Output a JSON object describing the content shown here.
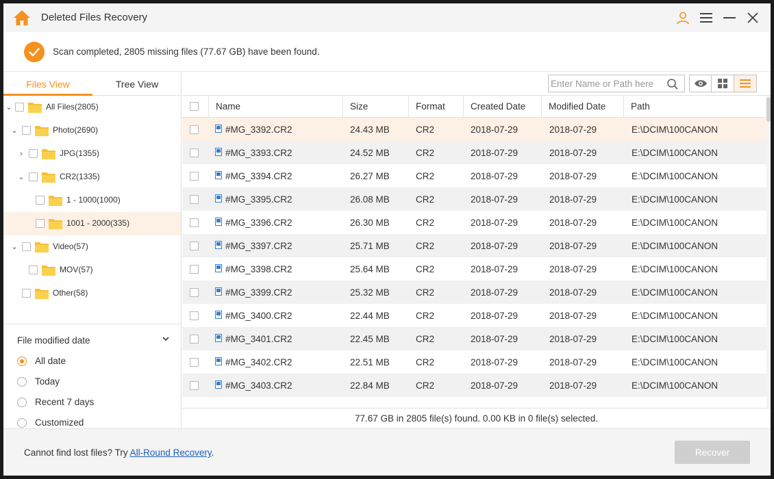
{
  "app": {
    "title": "Deleted Files Recovery"
  },
  "status": {
    "message": "Scan completed, 2805 missing files (77.67 GB) have been found."
  },
  "tabs": [
    {
      "label": "Files View"
    },
    {
      "label": "Tree View"
    }
  ],
  "tree": [
    {
      "label": "All Files(2805)",
      "expanded": true
    },
    {
      "label": "Photo(2690)",
      "expanded": true
    },
    {
      "label": "JPG(1355)",
      "expanded": false
    },
    {
      "label": "CR2(1335)",
      "expanded": true
    },
    {
      "label": "1 - 1000(1000)"
    },
    {
      "label": "1001 - 2000(335)",
      "selected": true
    },
    {
      "label": "Video(57)",
      "expanded": true
    },
    {
      "label": "MOV(57)"
    },
    {
      "label": "Other(58)"
    }
  ],
  "filter": {
    "title": "File modified date",
    "options": [
      {
        "label": "All date",
        "selected": true
      },
      {
        "label": "Today"
      },
      {
        "label": "Recent 7 days"
      },
      {
        "label": "Customized"
      }
    ]
  },
  "search": {
    "placeholder": "Enter Name or Path here"
  },
  "table": {
    "columns": [
      "Name",
      "Size",
      "Format",
      "Created Date",
      "Modified Date",
      "Path"
    ],
    "rows": [
      {
        "name": "#MG_3392.CR2",
        "size": "24.43 MB",
        "format": "CR2",
        "created": "2018-07-29",
        "modified": "2018-07-29",
        "path": "E:\\DCIM\\100CANON"
      },
      {
        "name": "#MG_3393.CR2",
        "size": "24.52 MB",
        "format": "CR2",
        "created": "2018-07-29",
        "modified": "2018-07-29",
        "path": "E:\\DCIM\\100CANON"
      },
      {
        "name": "#MG_3394.CR2",
        "size": "26.27 MB",
        "format": "CR2",
        "created": "2018-07-29",
        "modified": "2018-07-29",
        "path": "E:\\DCIM\\100CANON"
      },
      {
        "name": "#MG_3395.CR2",
        "size": "26.08 MB",
        "format": "CR2",
        "created": "2018-07-29",
        "modified": "2018-07-29",
        "path": "E:\\DCIM\\100CANON"
      },
      {
        "name": "#MG_3396.CR2",
        "size": "26.30 MB",
        "format": "CR2",
        "created": "2018-07-29",
        "modified": "2018-07-29",
        "path": "E:\\DCIM\\100CANON"
      },
      {
        "name": "#MG_3397.CR2",
        "size": "25.71 MB",
        "format": "CR2",
        "created": "2018-07-29",
        "modified": "2018-07-29",
        "path": "E:\\DCIM\\100CANON"
      },
      {
        "name": "#MG_3398.CR2",
        "size": "25.64 MB",
        "format": "CR2",
        "created": "2018-07-29",
        "modified": "2018-07-29",
        "path": "E:\\DCIM\\100CANON"
      },
      {
        "name": "#MG_3399.CR2",
        "size": "25.32 MB",
        "format": "CR2",
        "created": "2018-07-29",
        "modified": "2018-07-29",
        "path": "E:\\DCIM\\100CANON"
      },
      {
        "name": "#MG_3400.CR2",
        "size": "22.44 MB",
        "format": "CR2",
        "created": "2018-07-29",
        "modified": "2018-07-29",
        "path": "E:\\DCIM\\100CANON"
      },
      {
        "name": "#MG_3401.CR2",
        "size": "22.45 MB",
        "format": "CR2",
        "created": "2018-07-29",
        "modified": "2018-07-29",
        "path": "E:\\DCIM\\100CANON"
      },
      {
        "name": "#MG_3402.CR2",
        "size": "22.51 MB",
        "format": "CR2",
        "created": "2018-07-29",
        "modified": "2018-07-29",
        "path": "E:\\DCIM\\100CANON"
      },
      {
        "name": "#MG_3403.CR2",
        "size": "22.84 MB",
        "format": "CR2",
        "created": "2018-07-29",
        "modified": "2018-07-29",
        "path": "E:\\DCIM\\100CANON"
      }
    ]
  },
  "summary": "77.67 GB in 2805 file(s) found. 0.00 KB in 0 file(s) selected.",
  "footer": {
    "prefix": "Cannot find lost files? Try ",
    "link": "All-Round Recovery",
    "suffix": "."
  },
  "recover_button": "Recover",
  "colors": {
    "accent": "#f5911e",
    "selected_row": "#fdf0e5",
    "alt_row": "#f1f1f1",
    "link": "#1a5fb4"
  },
  "icons": [
    "home-icon",
    "user-icon",
    "menu-icon",
    "minimize-icon",
    "close-icon",
    "check-icon",
    "folder-icon",
    "image-file-icon",
    "search-icon",
    "eye-icon",
    "grid-view-icon",
    "list-view-icon",
    "chevron-down-icon"
  ]
}
